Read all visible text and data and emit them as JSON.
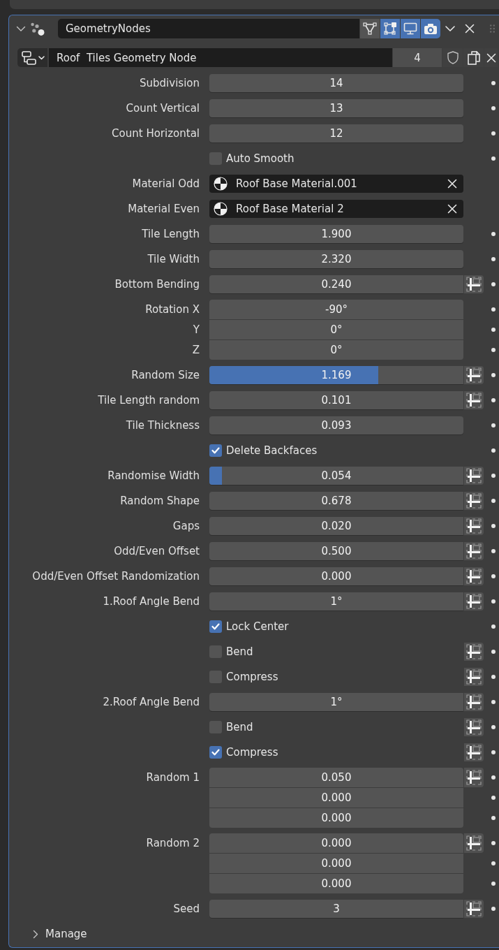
{
  "modifier": {
    "expanded": true,
    "name": "GeometryNodes",
    "toggles": [
      {
        "kind": "cage",
        "on": false
      },
      {
        "kind": "edit_mode",
        "on": true
      },
      {
        "kind": "viewport",
        "on": true
      },
      {
        "kind": "render",
        "on": true
      }
    ]
  },
  "node_group": {
    "name": "Roof  Tiles Geometry Node",
    "users": "4",
    "fake_user": false
  },
  "inputs": [
    {
      "kind": "number",
      "label": "Subdivision",
      "value": "14",
      "attribute_toggle": false,
      "keyframe": true
    },
    {
      "kind": "number",
      "label": "Count Vertical",
      "value": "13",
      "attribute_toggle": false,
      "keyframe": true
    },
    {
      "kind": "number",
      "label": "Count Horizontal",
      "value": "12",
      "attribute_toggle": false,
      "keyframe": true
    },
    {
      "kind": "checkbox",
      "label": "Auto Smooth",
      "checked": false,
      "attribute_toggle": false,
      "keyframe": true
    },
    {
      "kind": "material",
      "label": "Material Odd",
      "value": "Roof Base Material.001",
      "attribute_toggle": false,
      "keyframe": false
    },
    {
      "kind": "material",
      "label": "Material Even",
      "value": "Roof Base Material 2",
      "attribute_toggle": false,
      "keyframe": false
    },
    {
      "kind": "number",
      "label": "Tile Length",
      "value": "1.900",
      "attribute_toggle": false,
      "keyframe": true
    },
    {
      "kind": "number",
      "label": "Tile Width",
      "value": "2.320",
      "attribute_toggle": false,
      "keyframe": true
    },
    {
      "kind": "number",
      "label": "Bottom Bending",
      "value": "0.240",
      "attribute_toggle": true,
      "keyframe": true
    },
    {
      "kind": "vector",
      "components": [
        {
          "label": "Rotation X",
          "value": "-90°"
        },
        {
          "label": "Y",
          "value": "0°"
        },
        {
          "label": "Z",
          "value": "0°"
        }
      ],
      "attribute_toggle": false,
      "keyframe": true
    },
    {
      "kind": "slider",
      "label": "Random Size",
      "value": "1.169",
      "level": 0.665,
      "attribute_toggle": true,
      "keyframe": true
    },
    {
      "kind": "number",
      "label": "Tile Length random",
      "value": "0.101",
      "attribute_toggle": true,
      "keyframe": true
    },
    {
      "kind": "number",
      "label": "Tile Thickness",
      "value": "0.093",
      "attribute_toggle": false,
      "keyframe": true
    },
    {
      "kind": "checkbox",
      "label": "Delete Backfaces",
      "checked": true,
      "attribute_toggle": false,
      "keyframe": true
    },
    {
      "kind": "slider",
      "label": "Randomise Width",
      "value": "0.054",
      "level": 0.05,
      "attribute_toggle": true,
      "keyframe": true
    },
    {
      "kind": "number",
      "label": "Random Shape",
      "value": "0.678",
      "attribute_toggle": true,
      "keyframe": true
    },
    {
      "kind": "number",
      "label": "Gaps",
      "value": "0.020",
      "attribute_toggle": true,
      "keyframe": true
    },
    {
      "kind": "number",
      "label": "Odd/Even Offset",
      "value": "0.500",
      "attribute_toggle": true,
      "keyframe": true
    },
    {
      "kind": "number",
      "label": "Odd/Even Offset Randomization",
      "value": "0.000",
      "attribute_toggle": true,
      "keyframe": true
    },
    {
      "kind": "number",
      "label": "1.Roof Angle Bend",
      "value": "1°",
      "attribute_toggle": true,
      "keyframe": true
    },
    {
      "kind": "checkbox",
      "label": "Lock Center",
      "checked": true,
      "attribute_toggle": false,
      "keyframe": true
    },
    {
      "kind": "checkbox",
      "label": "Bend",
      "checked": false,
      "attribute_toggle": true,
      "keyframe": true
    },
    {
      "kind": "checkbox",
      "label": "Compress",
      "checked": false,
      "attribute_toggle": true,
      "keyframe": true
    },
    {
      "kind": "number",
      "label": "2.Roof Angle Bend",
      "value": "1°",
      "attribute_toggle": true,
      "keyframe": true
    },
    {
      "kind": "checkbox",
      "label": "Bend",
      "checked": false,
      "attribute_toggle": true,
      "keyframe": true
    },
    {
      "kind": "checkbox",
      "label": "Compress",
      "checked": true,
      "attribute_toggle": true,
      "keyframe": true
    },
    {
      "kind": "vector",
      "label": "Random 1",
      "components": [
        {
          "value": "0.050"
        },
        {
          "value": "0.000"
        },
        {
          "value": "0.000"
        }
      ],
      "attribute_toggle": true,
      "keyframe": true
    },
    {
      "kind": "vector",
      "label": "Random 2",
      "components": [
        {
          "value": "0.000"
        },
        {
          "value": "0.000"
        },
        {
          "value": "0.000"
        }
      ],
      "attribute_toggle": true,
      "keyframe": true
    },
    {
      "kind": "number",
      "label": "Seed",
      "value": "3",
      "attribute_toggle": true,
      "keyframe": true
    }
  ],
  "manage": {
    "title": "Manage",
    "expanded": false
  }
}
